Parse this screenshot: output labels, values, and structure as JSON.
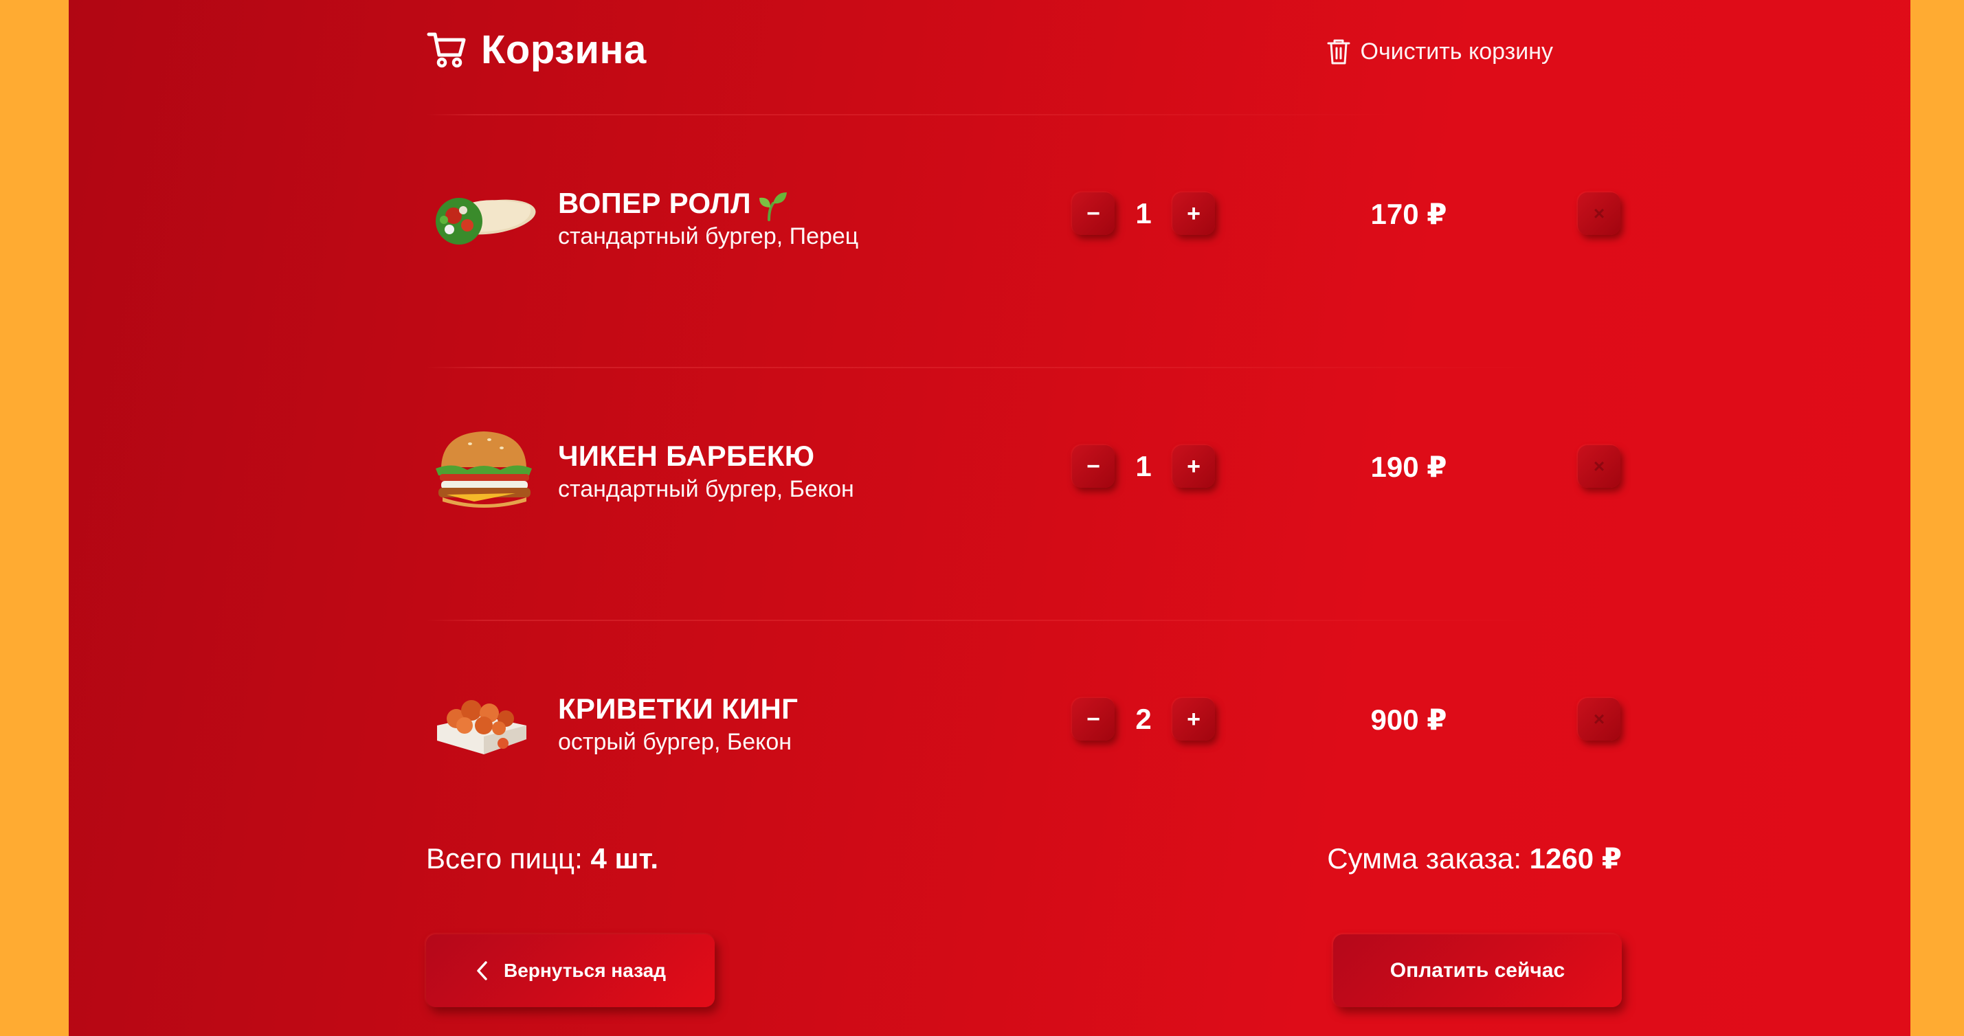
{
  "header": {
    "title": "Корзина",
    "clear_label": "Очистить корзину"
  },
  "items": [
    {
      "name": "ВОПЕР РОЛЛ",
      "desc": "стандартный бургер, Перец",
      "qty": "1",
      "price": "170 ₽",
      "vegan": true,
      "thumb": "wrap"
    },
    {
      "name": "ЧИКЕН БАРБЕКЮ",
      "desc": "стандартный бургер, Бекон",
      "qty": "1",
      "price": "190 ₽",
      "vegan": false,
      "thumb": "burger"
    },
    {
      "name": "КРИВЕТКИ КИНГ",
      "desc": "острый бургер, Бекон",
      "qty": "2",
      "price": "900 ₽",
      "vegan": false,
      "thumb": "shrimp-box"
    }
  ],
  "controls": {
    "minus": "−",
    "plus": "+",
    "remove": "×"
  },
  "totals": {
    "count_label": "Всего пицц:",
    "count_value": "4 шт.",
    "sum_label": "Сумма заказа:",
    "sum_value": "1260 ₽"
  },
  "buttons": {
    "back": "Вернуться назад",
    "pay": "Оплатить сейчас"
  },
  "colors": {
    "page_bg": "#FFAB32",
    "panel_red": "#D90B17",
    "text": "#FFFFFF"
  }
}
